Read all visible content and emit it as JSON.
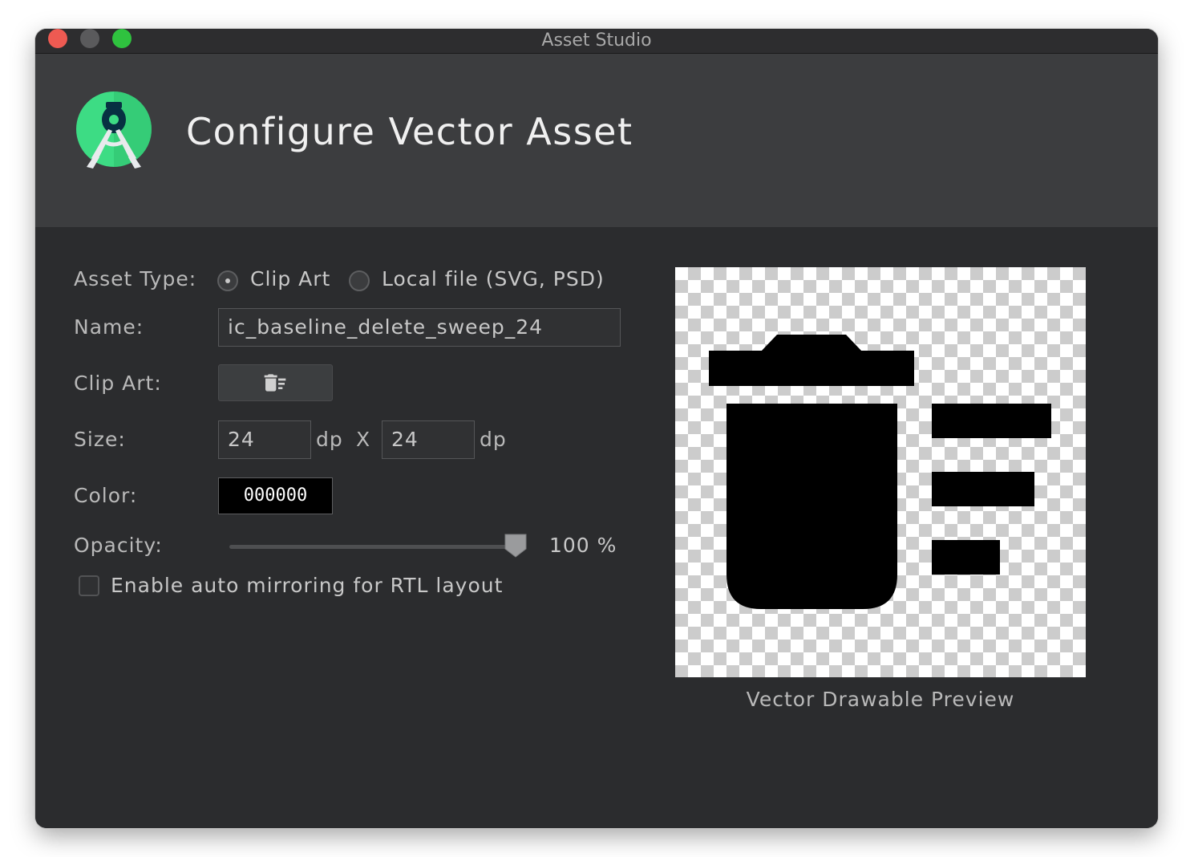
{
  "window": {
    "title": "Asset Studio"
  },
  "header": {
    "title": "Configure Vector Asset",
    "logo_icon": "android-studio-logo-icon"
  },
  "form": {
    "asset_type": {
      "label": "Asset Type:",
      "options": [
        {
          "label": "Clip Art",
          "selected": true
        },
        {
          "label": "Local file (SVG, PSD)",
          "selected": false
        }
      ]
    },
    "name": {
      "label": "Name:",
      "value": "ic_baseline_delete_sweep_24"
    },
    "clip_art": {
      "label": "Clip Art:",
      "icon": "delete-sweep-icon"
    },
    "size": {
      "label": "Size:",
      "width": "24",
      "height": "24",
      "unit": "dp",
      "separator": "X"
    },
    "color": {
      "label": "Color:",
      "value": "000000",
      "hex": "#000000"
    },
    "opacity": {
      "label": "Opacity:",
      "value_label": "100 %",
      "fraction": 1.0
    },
    "auto_mirror": {
      "label": "Enable auto mirroring for RTL layout",
      "checked": false
    }
  },
  "preview": {
    "caption": "Vector Drawable Preview",
    "icon": "delete-sweep-icon"
  }
}
